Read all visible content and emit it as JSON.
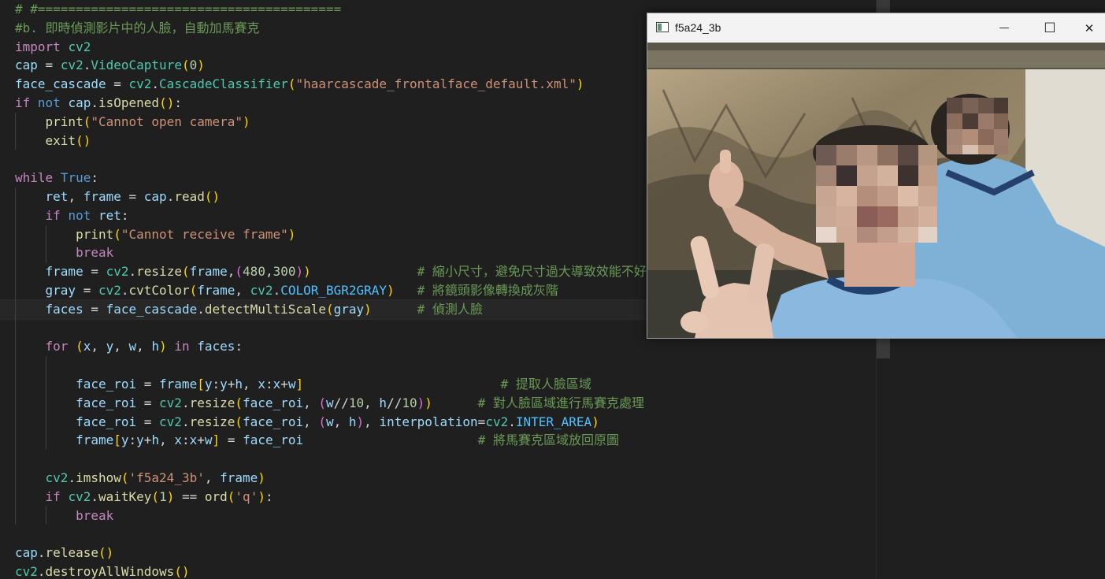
{
  "editor": {
    "lines": [
      [
        [
          "cm",
          "# #========================================"
        ]
      ],
      [
        [
          "cm",
          "#b. 即時偵測影片中的人臉，自動加馬賽克"
        ]
      ],
      [
        [
          "kw",
          "import"
        ],
        [
          "op",
          " "
        ],
        [
          "md",
          "cv2"
        ]
      ],
      [
        [
          "vr",
          "cap"
        ],
        [
          "op",
          " = "
        ],
        [
          "md",
          "cv2"
        ],
        [
          "op",
          "."
        ],
        [
          "md",
          "VideoCapture"
        ],
        [
          "p1",
          "("
        ],
        [
          "nm",
          "0"
        ],
        [
          "p1",
          ")"
        ]
      ],
      [
        [
          "vr",
          "face_cascade"
        ],
        [
          "op",
          " = "
        ],
        [
          "md",
          "cv2"
        ],
        [
          "op",
          "."
        ],
        [
          "md",
          "CascadeClassifier"
        ],
        [
          "p1",
          "("
        ],
        [
          "st",
          "\"haarcascade_frontalface_default.xml\""
        ],
        [
          "p1",
          ")"
        ]
      ],
      [
        [
          "kw",
          "if"
        ],
        [
          "op",
          " "
        ],
        [
          "kb",
          "not"
        ],
        [
          "op",
          " "
        ],
        [
          "vr",
          "cap"
        ],
        [
          "op",
          "."
        ],
        [
          "fn",
          "isOpened"
        ],
        [
          "p1",
          "()"
        ],
        [
          "op",
          ":"
        ]
      ],
      [
        [
          "op",
          "    "
        ],
        [
          "fn",
          "print"
        ],
        [
          "p1",
          "("
        ],
        [
          "st",
          "\"Cannot open camera\""
        ],
        [
          "p1",
          ")"
        ]
      ],
      [
        [
          "op",
          "    "
        ],
        [
          "fn",
          "exit"
        ],
        [
          "p1",
          "()"
        ]
      ],
      [
        [
          "op",
          ""
        ]
      ],
      [
        [
          "kw",
          "while"
        ],
        [
          "op",
          " "
        ],
        [
          "kb",
          "True"
        ],
        [
          "op",
          ":"
        ]
      ],
      [
        [
          "op",
          "    "
        ],
        [
          "vr",
          "ret"
        ],
        [
          "op",
          ", "
        ],
        [
          "vr",
          "frame"
        ],
        [
          "op",
          " = "
        ],
        [
          "vr",
          "cap"
        ],
        [
          "op",
          "."
        ],
        [
          "fn",
          "read"
        ],
        [
          "p1",
          "()"
        ]
      ],
      [
        [
          "op",
          "    "
        ],
        [
          "kw",
          "if"
        ],
        [
          "op",
          " "
        ],
        [
          "kb",
          "not"
        ],
        [
          "op",
          " "
        ],
        [
          "vr",
          "ret"
        ],
        [
          "op",
          ":"
        ]
      ],
      [
        [
          "op",
          "        "
        ],
        [
          "fn",
          "print"
        ],
        [
          "p1",
          "("
        ],
        [
          "st",
          "\"Cannot receive frame\""
        ],
        [
          "p1",
          ")"
        ]
      ],
      [
        [
          "op",
          "        "
        ],
        [
          "kw",
          "break"
        ]
      ],
      [
        [
          "op",
          "    "
        ],
        [
          "vr",
          "frame"
        ],
        [
          "op",
          " = "
        ],
        [
          "md",
          "cv2"
        ],
        [
          "op",
          "."
        ],
        [
          "fn",
          "resize"
        ],
        [
          "p1",
          "("
        ],
        [
          "vr",
          "frame"
        ],
        [
          "op",
          ","
        ],
        [
          "p2",
          "("
        ],
        [
          "nm",
          "480"
        ],
        [
          "op",
          ","
        ],
        [
          "nm",
          "300"
        ],
        [
          "p2",
          ")"
        ],
        [
          "p1",
          ")"
        ],
        [
          "op",
          "              "
        ],
        [
          "cm",
          "# 縮小尺寸，避免尺寸過大導致效能不好"
        ]
      ],
      [
        [
          "op",
          "    "
        ],
        [
          "vr",
          "gray"
        ],
        [
          "op",
          " = "
        ],
        [
          "md",
          "cv2"
        ],
        [
          "op",
          "."
        ],
        [
          "fn",
          "cvtColor"
        ],
        [
          "p1",
          "("
        ],
        [
          "vr",
          "frame"
        ],
        [
          "op",
          ", "
        ],
        [
          "md",
          "cv2"
        ],
        [
          "op",
          "."
        ],
        [
          "cn",
          "COLOR_BGR2GRAY"
        ],
        [
          "p1",
          ")"
        ],
        [
          "op",
          "   "
        ],
        [
          "cm",
          "# 將鏡頭影像轉換成灰階"
        ]
      ],
      [
        [
          "op",
          "    "
        ],
        [
          "vr",
          "faces"
        ],
        [
          "op",
          " = "
        ],
        [
          "vr",
          "face_cascade"
        ],
        [
          "op",
          "."
        ],
        [
          "fn",
          "detectMultiScale"
        ],
        [
          "p1",
          "("
        ],
        [
          "vr",
          "gray"
        ],
        [
          "p1",
          ")"
        ],
        [
          "op",
          "      "
        ],
        [
          "cm",
          "# 偵測人臉"
        ]
      ],
      [
        [
          "op",
          ""
        ]
      ],
      [
        [
          "op",
          "    "
        ],
        [
          "kw",
          "for"
        ],
        [
          "op",
          " "
        ],
        [
          "p1",
          "("
        ],
        [
          "vr",
          "x"
        ],
        [
          "op",
          ", "
        ],
        [
          "vr",
          "y"
        ],
        [
          "op",
          ", "
        ],
        [
          "vr",
          "w"
        ],
        [
          "op",
          ", "
        ],
        [
          "vr",
          "h"
        ],
        [
          "p1",
          ")"
        ],
        [
          "op",
          " "
        ],
        [
          "kw",
          "in"
        ],
        [
          "op",
          " "
        ],
        [
          "vr",
          "faces"
        ],
        [
          "op",
          ":"
        ]
      ],
      [
        [
          "op",
          ""
        ]
      ],
      [
        [
          "op",
          "        "
        ],
        [
          "vr",
          "face_roi"
        ],
        [
          "op",
          " = "
        ],
        [
          "vr",
          "frame"
        ],
        [
          "p1",
          "["
        ],
        [
          "vr",
          "y"
        ],
        [
          "op",
          ":"
        ],
        [
          "vr",
          "y"
        ],
        [
          "op",
          "+"
        ],
        [
          "vr",
          "h"
        ],
        [
          "op",
          ", "
        ],
        [
          "vr",
          "x"
        ],
        [
          "op",
          ":"
        ],
        [
          "vr",
          "x"
        ],
        [
          "op",
          "+"
        ],
        [
          "vr",
          "w"
        ],
        [
          "p1",
          "]"
        ],
        [
          "op",
          "                          "
        ],
        [
          "cm",
          "# 提取人臉區域"
        ]
      ],
      [
        [
          "op",
          "        "
        ],
        [
          "vr",
          "face_roi"
        ],
        [
          "op",
          " = "
        ],
        [
          "md",
          "cv2"
        ],
        [
          "op",
          "."
        ],
        [
          "fn",
          "resize"
        ],
        [
          "p1",
          "("
        ],
        [
          "vr",
          "face_roi"
        ],
        [
          "op",
          ", "
        ],
        [
          "p2",
          "("
        ],
        [
          "vr",
          "w"
        ],
        [
          "op",
          "//"
        ],
        [
          "nm",
          "10"
        ],
        [
          "op",
          ", "
        ],
        [
          "vr",
          "h"
        ],
        [
          "op",
          "//"
        ],
        [
          "nm",
          "10"
        ],
        [
          "p2",
          ")"
        ],
        [
          "p1",
          ")"
        ],
        [
          "op",
          "      "
        ],
        [
          "cm",
          "# 對人臉區域進行馬賽克處理"
        ]
      ],
      [
        [
          "op",
          "        "
        ],
        [
          "vr",
          "face_roi"
        ],
        [
          "op",
          " = "
        ],
        [
          "md",
          "cv2"
        ],
        [
          "op",
          "."
        ],
        [
          "fn",
          "resize"
        ],
        [
          "p1",
          "("
        ],
        [
          "vr",
          "face_roi"
        ],
        [
          "op",
          ", "
        ],
        [
          "p2",
          "("
        ],
        [
          "vr",
          "w"
        ],
        [
          "op",
          ", "
        ],
        [
          "vr",
          "h"
        ],
        [
          "p2",
          ")"
        ],
        [
          "op",
          ", "
        ],
        [
          "vr",
          "interpolation"
        ],
        [
          "op",
          "="
        ],
        [
          "md",
          "cv2"
        ],
        [
          "op",
          "."
        ],
        [
          "cn",
          "INTER_AREA"
        ],
        [
          "p1",
          ")"
        ]
      ],
      [
        [
          "op",
          "        "
        ],
        [
          "vr",
          "frame"
        ],
        [
          "p1",
          "["
        ],
        [
          "vr",
          "y"
        ],
        [
          "op",
          ":"
        ],
        [
          "vr",
          "y"
        ],
        [
          "op",
          "+"
        ],
        [
          "vr",
          "h"
        ],
        [
          "op",
          ", "
        ],
        [
          "vr",
          "x"
        ],
        [
          "op",
          ":"
        ],
        [
          "vr",
          "x"
        ],
        [
          "op",
          "+"
        ],
        [
          "vr",
          "w"
        ],
        [
          "p1",
          "]"
        ],
        [
          "op",
          " = "
        ],
        [
          "vr",
          "face_roi"
        ],
        [
          "op",
          "                       "
        ],
        [
          "cm",
          "# 將馬賽克區域放回原圖"
        ]
      ],
      [
        [
          "op",
          ""
        ]
      ],
      [
        [
          "op",
          "    "
        ],
        [
          "md",
          "cv2"
        ],
        [
          "op",
          "."
        ],
        [
          "fn",
          "imshow"
        ],
        [
          "p1",
          "("
        ],
        [
          "st",
          "'f5a24_3b'"
        ],
        [
          "op",
          ", "
        ],
        [
          "vr",
          "frame"
        ],
        [
          "p1",
          ")"
        ]
      ],
      [
        [
          "op",
          "    "
        ],
        [
          "kw",
          "if"
        ],
        [
          "op",
          " "
        ],
        [
          "md",
          "cv2"
        ],
        [
          "op",
          "."
        ],
        [
          "fn",
          "waitKey"
        ],
        [
          "p1",
          "("
        ],
        [
          "nm",
          "1"
        ],
        [
          "p1",
          ")"
        ],
        [
          "op",
          " == "
        ],
        [
          "fn",
          "ord"
        ],
        [
          "p1",
          "("
        ],
        [
          "st",
          "'q'"
        ],
        [
          "p1",
          ")"
        ],
        [
          "op",
          ":"
        ]
      ],
      [
        [
          "op",
          "        "
        ],
        [
          "kw",
          "break"
        ]
      ],
      [
        [
          "op",
          ""
        ]
      ],
      [
        [
          "vr",
          "cap"
        ],
        [
          "op",
          "."
        ],
        [
          "fn",
          "release"
        ],
        [
          "p1",
          "()"
        ]
      ],
      [
        [
          "md",
          "cv2"
        ],
        [
          "op",
          "."
        ],
        [
          "fn",
          "destroyAllWindows"
        ],
        [
          "p1",
          "()"
        ]
      ]
    ]
  },
  "cv_window": {
    "title": "f5a24_3b",
    "minimize_label": "—",
    "maximize_label": "☐",
    "close_label": "✕"
  }
}
